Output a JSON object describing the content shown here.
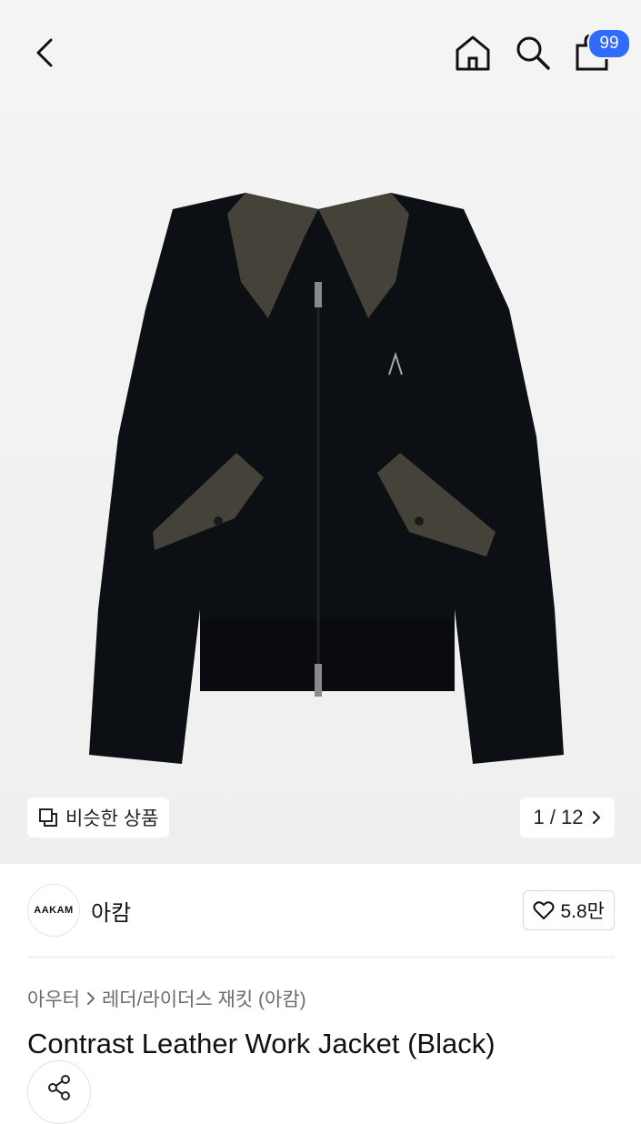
{
  "nav": {
    "back_icon": "chevron-left-icon",
    "home_icon": "home-icon",
    "search_icon": "search-icon",
    "cart_icon": "shopping-bag-icon",
    "cart_badge": "99",
    "badge_color": "#2f6bff"
  },
  "gallery": {
    "similar_label": "비슷한 상품",
    "pager": "1 / 12",
    "image_subject": "black zip-up work jacket with brown leather collar and pocket flaps"
  },
  "brand": {
    "logo_text": "AAKAM",
    "name": "아캄",
    "likes": "5.8만"
  },
  "breadcrumb": {
    "category": "아우터",
    "subcategory": "레더/라이더스 재킷 (아캄)"
  },
  "product": {
    "title": "Contrast Leather Work Jacket (Black)"
  }
}
